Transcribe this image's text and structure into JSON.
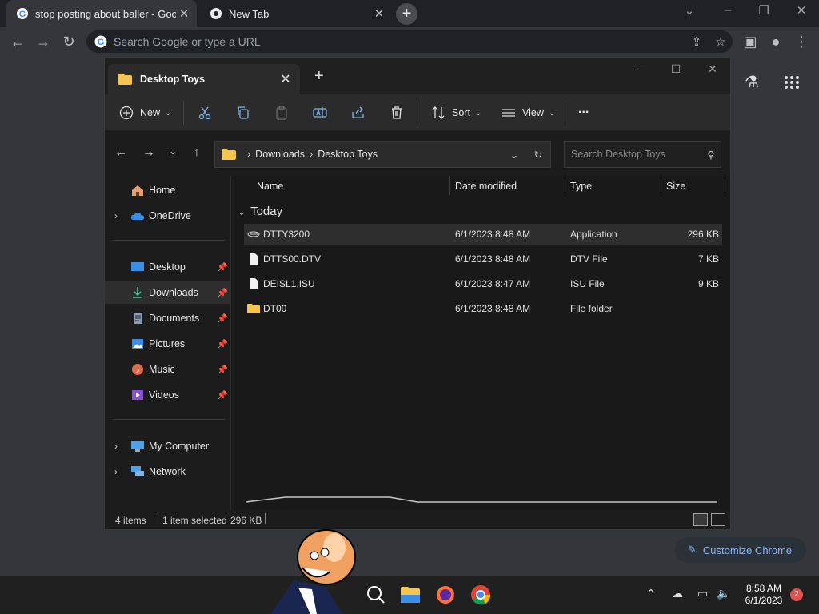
{
  "browser": {
    "tabs": [
      {
        "title": "stop posting about baller - Goog",
        "active": true
      },
      {
        "title": "New Tab",
        "active": false
      }
    ],
    "new_tab_symbol": "+",
    "omnibox_placeholder": "Search Google or type a URL",
    "customize_label": "Customize Chrome"
  },
  "explorer": {
    "tab_title": "Desktop Toys",
    "commands": {
      "new_label": "New",
      "sort_label": "Sort",
      "view_label": "View",
      "more_label": "..."
    },
    "breadcrumb": [
      "Downloads",
      "Desktop Toys"
    ],
    "search_placeholder": "Search Desktop Toys",
    "sidebar": {
      "top": [
        {
          "label": "Home",
          "icon": "home-icon",
          "expandable": false
        },
        {
          "label": "OneDrive",
          "icon": "cloud-icon",
          "expandable": true
        }
      ],
      "quick": [
        {
          "label": "Desktop",
          "icon": "desktop-icon",
          "pinned": true
        },
        {
          "label": "Downloads",
          "icon": "download-icon",
          "pinned": true,
          "selected": true
        },
        {
          "label": "Documents",
          "icon": "documents-icon",
          "pinned": true
        },
        {
          "label": "Pictures",
          "icon": "pictures-icon",
          "pinned": true
        },
        {
          "label": "Music",
          "icon": "music-icon",
          "pinned": true
        },
        {
          "label": "Videos",
          "icon": "videos-icon",
          "pinned": true
        }
      ],
      "devices": [
        {
          "label": "My Computer",
          "icon": "computer-icon",
          "expandable": true
        },
        {
          "label": "Network",
          "icon": "network-icon",
          "expandable": true
        }
      ]
    },
    "columns": [
      "Name",
      "Date modified",
      "Type",
      "Size"
    ],
    "group_label": "Today",
    "files": [
      {
        "name": "DTTY3200",
        "date": "6/1/2023 8:48 AM",
        "type": "Application",
        "size": "296 KB",
        "icon": "application-icon",
        "selected": true
      },
      {
        "name": "DTTS00.DTV",
        "date": "6/1/2023 8:48 AM",
        "type": "DTV File",
        "size": "7 KB",
        "icon": "file-icon",
        "selected": false
      },
      {
        "name": "DEISL1.ISU",
        "date": "6/1/2023 8:47 AM",
        "type": "ISU File",
        "size": "9 KB",
        "icon": "file-icon",
        "selected": false
      },
      {
        "name": "DT00",
        "date": "6/1/2023 8:48 AM",
        "type": "File folder",
        "size": "",
        "icon": "folder-icon",
        "selected": false
      }
    ],
    "status": {
      "items": "4 items",
      "selected": "1 item selected",
      "size": "296 KB"
    }
  },
  "taskbar": {
    "time": "8:58 AM",
    "date": "6/1/2023",
    "notification_count": "2"
  },
  "colors": {
    "chrome_frame": "#202124",
    "chrome_toolbar": "#35363a",
    "explorer_bg": "#1c1c1c",
    "accent_blue": "#8ab4f8",
    "folder_yellow": "#f5c451",
    "badge_red": "#e0524d"
  }
}
